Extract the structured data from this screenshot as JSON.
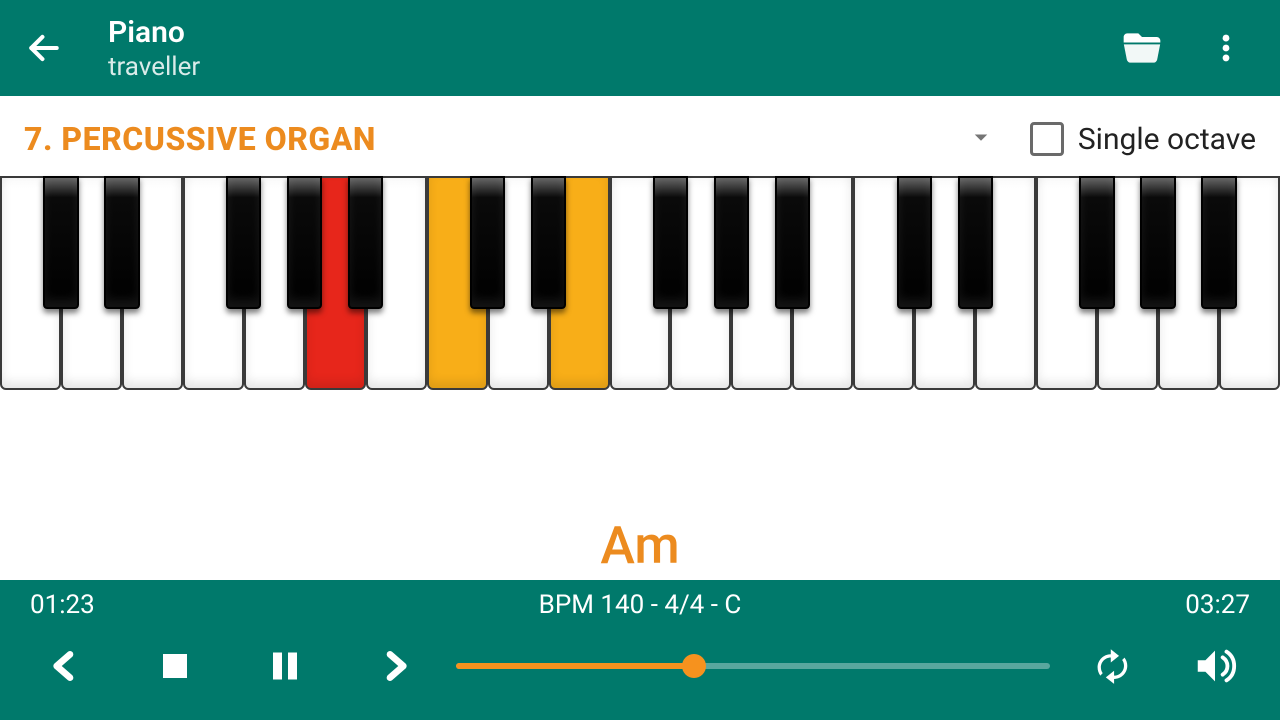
{
  "header": {
    "title": "Piano",
    "subtitle": "traveller"
  },
  "instrument": {
    "label": "7. PERCUSSIVE ORGAN",
    "single_octave_label": "Single octave",
    "single_octave_checked": false
  },
  "chord": {
    "current": "Am"
  },
  "keyboard": {
    "white_count": 21,
    "black_pattern": [
      true,
      true,
      false,
      true,
      true,
      true,
      false
    ],
    "root_white_index": 5,
    "highlight_white_indices": [
      7,
      9
    ]
  },
  "player": {
    "elapsed": "01:23",
    "total": "03:27",
    "meta": "BPM 140 - 4/4 - C",
    "progress_pct": 40
  },
  "colors": {
    "accent": "#f6921e",
    "header": "#00796b",
    "root_key": "#e7261b",
    "highlight_key": "#f8ae18"
  }
}
